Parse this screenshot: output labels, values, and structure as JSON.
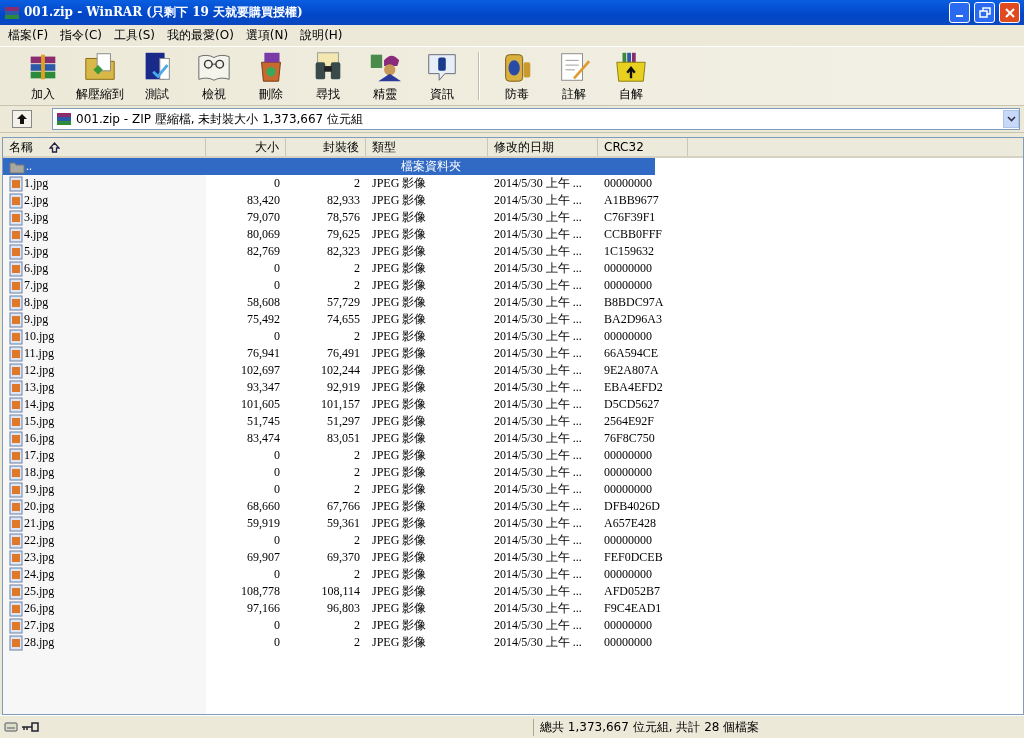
{
  "window": {
    "title": "001.zip - WinRAR (只剩下 19 天就要購買授權)"
  },
  "menu": [
    "檔案(F)",
    "指令(C)",
    "工具(S)",
    "我的最愛(O)",
    "選項(N)",
    "說明(H)"
  ],
  "toolbar": {
    "groups": [
      [
        "加入",
        "解壓縮到",
        "測試",
        "檢視",
        "刪除",
        "尋找",
        "精靈",
        "資訊"
      ],
      [
        "防毒",
        "註解",
        "自解"
      ]
    ]
  },
  "address": {
    "value": "001.zip - ZIP 壓縮檔, 未封裝大小 1,373,667 位元組"
  },
  "columns": [
    {
      "label": "名稱",
      "sorted": true
    },
    {
      "label": "大小",
      "sorted": false
    },
    {
      "label": "封裝後",
      "sorted": false
    },
    {
      "label": "類型",
      "sorted": false
    },
    {
      "label": "修改的日期",
      "sorted": false
    },
    {
      "label": "CRC32",
      "sorted": false
    }
  ],
  "rows": [
    {
      "kind": "folder",
      "selected": true,
      "cells": [
        "..",
        "",
        "",
        "檔案資料夾",
        "",
        ""
      ]
    },
    {
      "kind": "file",
      "selected": false,
      "cells": [
        "1.jpg",
        "0",
        "2",
        "JPEG 影像",
        "2014/5/30 上午 ...",
        "00000000"
      ]
    },
    {
      "kind": "file",
      "selected": false,
      "cells": [
        "2.jpg",
        "83,420",
        "82,933",
        "JPEG 影像",
        "2014/5/30 上午 ...",
        "A1BB9677"
      ]
    },
    {
      "kind": "file",
      "selected": false,
      "cells": [
        "3.jpg",
        "79,070",
        "78,576",
        "JPEG 影像",
        "2014/5/30 上午 ...",
        "C76F39F1"
      ]
    },
    {
      "kind": "file",
      "selected": false,
      "cells": [
        "4.jpg",
        "80,069",
        "79,625",
        "JPEG 影像",
        "2014/5/30 上午 ...",
        "CCBB0FFF"
      ]
    },
    {
      "kind": "file",
      "selected": false,
      "cells": [
        "5.jpg",
        "82,769",
        "82,323",
        "JPEG 影像",
        "2014/5/30 上午 ...",
        "1C159632"
      ]
    },
    {
      "kind": "file",
      "selected": false,
      "cells": [
        "6.jpg",
        "0",
        "2",
        "JPEG 影像",
        "2014/5/30 上午 ...",
        "00000000"
      ]
    },
    {
      "kind": "file",
      "selected": false,
      "cells": [
        "7.jpg",
        "0",
        "2",
        "JPEG 影像",
        "2014/5/30 上午 ...",
        "00000000"
      ]
    },
    {
      "kind": "file",
      "selected": false,
      "cells": [
        "8.jpg",
        "58,608",
        "57,729",
        "JPEG 影像",
        "2014/5/30 上午 ...",
        "B8BDC97A"
      ]
    },
    {
      "kind": "file",
      "selected": false,
      "cells": [
        "9.jpg",
        "75,492",
        "74,655",
        "JPEG 影像",
        "2014/5/30 上午 ...",
        "BA2D96A3"
      ]
    },
    {
      "kind": "file",
      "selected": false,
      "cells": [
        "10.jpg",
        "0",
        "2",
        "JPEG 影像",
        "2014/5/30 上午 ...",
        "00000000"
      ]
    },
    {
      "kind": "file",
      "selected": false,
      "cells": [
        "11.jpg",
        "76,941",
        "76,491",
        "JPEG 影像",
        "2014/5/30 上午 ...",
        "66A594CE"
      ]
    },
    {
      "kind": "file",
      "selected": false,
      "cells": [
        "12.jpg",
        "102,697",
        "102,244",
        "JPEG 影像",
        "2014/5/30 上午 ...",
        "9E2A807A"
      ]
    },
    {
      "kind": "file",
      "selected": false,
      "cells": [
        "13.jpg",
        "93,347",
        "92,919",
        "JPEG 影像",
        "2014/5/30 上午 ...",
        "EBA4EFD2"
      ]
    },
    {
      "kind": "file",
      "selected": false,
      "cells": [
        "14.jpg",
        "101,605",
        "101,157",
        "JPEG 影像",
        "2014/5/30 上午 ...",
        "D5CD5627"
      ]
    },
    {
      "kind": "file",
      "selected": false,
      "cells": [
        "15.jpg",
        "51,745",
        "51,297",
        "JPEG 影像",
        "2014/5/30 上午 ...",
        "2564E92F"
      ]
    },
    {
      "kind": "file",
      "selected": false,
      "cells": [
        "16.jpg",
        "83,474",
        "83,051",
        "JPEG 影像",
        "2014/5/30 上午 ...",
        "76F8C750"
      ]
    },
    {
      "kind": "file",
      "selected": false,
      "cells": [
        "17.jpg",
        "0",
        "2",
        "JPEG 影像",
        "2014/5/30 上午 ...",
        "00000000"
      ]
    },
    {
      "kind": "file",
      "selected": false,
      "cells": [
        "18.jpg",
        "0",
        "2",
        "JPEG 影像",
        "2014/5/30 上午 ...",
        "00000000"
      ]
    },
    {
      "kind": "file",
      "selected": false,
      "cells": [
        "19.jpg",
        "0",
        "2",
        "JPEG 影像",
        "2014/5/30 上午 ...",
        "00000000"
      ]
    },
    {
      "kind": "file",
      "selected": false,
      "cells": [
        "20.jpg",
        "68,660",
        "67,766",
        "JPEG 影像",
        "2014/5/30 上午 ...",
        "DFB4026D"
      ]
    },
    {
      "kind": "file",
      "selected": false,
      "cells": [
        "21.jpg",
        "59,919",
        "59,361",
        "JPEG 影像",
        "2014/5/30 上午 ...",
        "A657E428"
      ]
    },
    {
      "kind": "file",
      "selected": false,
      "cells": [
        "22.jpg",
        "0",
        "2",
        "JPEG 影像",
        "2014/5/30 上午 ...",
        "00000000"
      ]
    },
    {
      "kind": "file",
      "selected": false,
      "cells": [
        "23.jpg",
        "69,907",
        "69,370",
        "JPEG 影像",
        "2014/5/30 上午 ...",
        "FEF0DCEB"
      ]
    },
    {
      "kind": "file",
      "selected": false,
      "cells": [
        "24.jpg",
        "0",
        "2",
        "JPEG 影像",
        "2014/5/30 上午 ...",
        "00000000"
      ]
    },
    {
      "kind": "file",
      "selected": false,
      "cells": [
        "25.jpg",
        "108,778",
        "108,114",
        "JPEG 影像",
        "2014/5/30 上午 ...",
        "AFD052B7"
      ]
    },
    {
      "kind": "file",
      "selected": false,
      "cells": [
        "26.jpg",
        "97,166",
        "96,803",
        "JPEG 影像",
        "2014/5/30 上午 ...",
        "F9C4EAD1"
      ]
    },
    {
      "kind": "file",
      "selected": false,
      "cells": [
        "27.jpg",
        "0",
        "2",
        "JPEG 影像",
        "2014/5/30 上午 ...",
        "00000000"
      ]
    },
    {
      "kind": "file",
      "selected": false,
      "cells": [
        "28.jpg",
        "0",
        "2",
        "JPEG 影像",
        "2014/5/30 上午 ...",
        "00000000"
      ]
    }
  ],
  "status_bar": {
    "text": "總共 1,373,667 位元組, 共計 28 個檔案"
  }
}
